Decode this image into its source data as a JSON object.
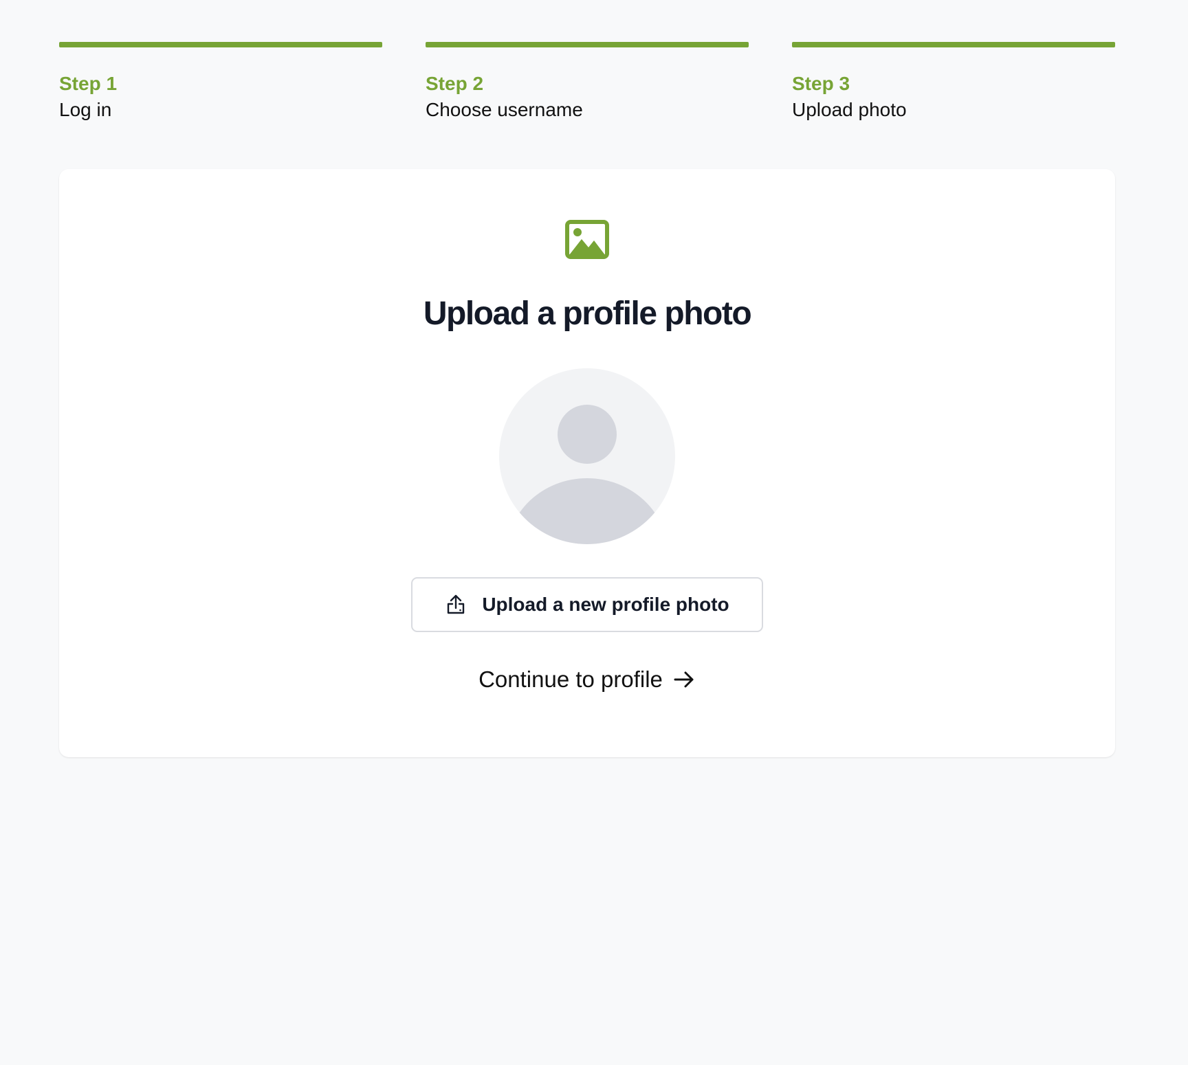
{
  "steps": [
    {
      "number": "Step 1",
      "title": "Log in"
    },
    {
      "number": "Step 2",
      "title": "Choose username"
    },
    {
      "number": "Step 3",
      "title": "Upload photo"
    }
  ],
  "card": {
    "icon": "image-icon",
    "title": "Upload a profile photo",
    "avatar": "default-user-avatar",
    "upload_button": {
      "icon": "upload-icon",
      "label": "Upload a new profile photo"
    },
    "continue_link": {
      "label": "Continue to profile",
      "icon": "arrow-right-icon"
    }
  },
  "colors": {
    "accent": "#77a435",
    "background": "#f8f9fa",
    "card": "#ffffff",
    "avatar_bg": "#f2f3f5",
    "avatar_fg": "#d4d6dd",
    "heading": "#141a28"
  }
}
